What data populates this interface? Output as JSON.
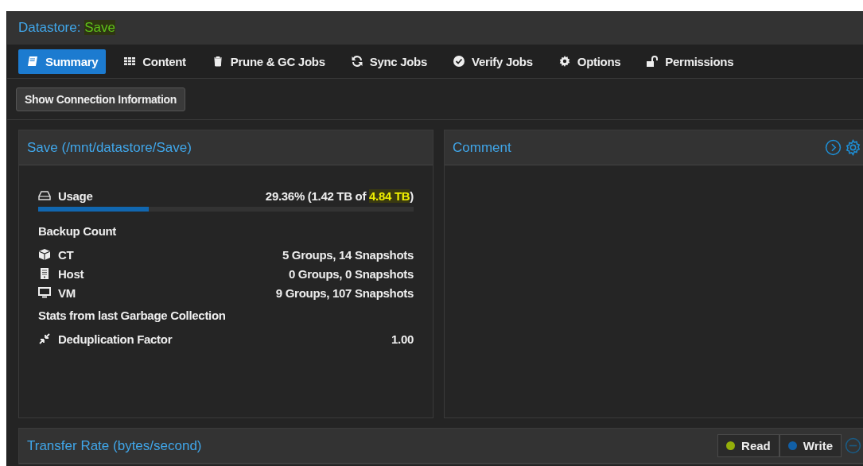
{
  "header": {
    "label": "Datastore:",
    "name": "Save"
  },
  "tabs": [
    {
      "label": "Summary",
      "selected": true
    },
    {
      "label": "Content",
      "selected": false
    },
    {
      "label": "Prune & GC Jobs",
      "selected": false
    },
    {
      "label": "Sync Jobs",
      "selected": false
    },
    {
      "label": "Verify Jobs",
      "selected": false
    },
    {
      "label": "Options",
      "selected": false
    },
    {
      "label": "Permissions",
      "selected": false
    }
  ],
  "toolbar": {
    "button": "Show Connection Information"
  },
  "summary": {
    "title": "Save (/mnt/datastore/Save)",
    "usage": {
      "label": "Usage",
      "reading_start": "29.36% (1.42 TB of ",
      "reading_total": "4.84 TB",
      "reading_end": ")",
      "level": 0.2936
    },
    "backup_heading": "Backup Count",
    "backups": [
      {
        "label": "CT",
        "value": "5 Groups, 14 Snapshots"
      },
      {
        "label": "Host",
        "value": "0 Groups, 0 Snapshots"
      },
      {
        "label": "VM",
        "value": "9 Groups, 107 Snapshots"
      }
    ],
    "gc_heading": "Stats from last Garbage Collection",
    "gc": [
      {
        "label": "Deduplication Factor",
        "value": "1.00"
      }
    ]
  },
  "comment": {
    "title": "Comment"
  },
  "transfer": {
    "title": "Transfer Rate (bytes/second)",
    "legend": [
      {
        "label": "Read",
        "color": "#94ae0a"
      },
      {
        "label": "Write",
        "color": "#115fa6"
      }
    ]
  }
}
